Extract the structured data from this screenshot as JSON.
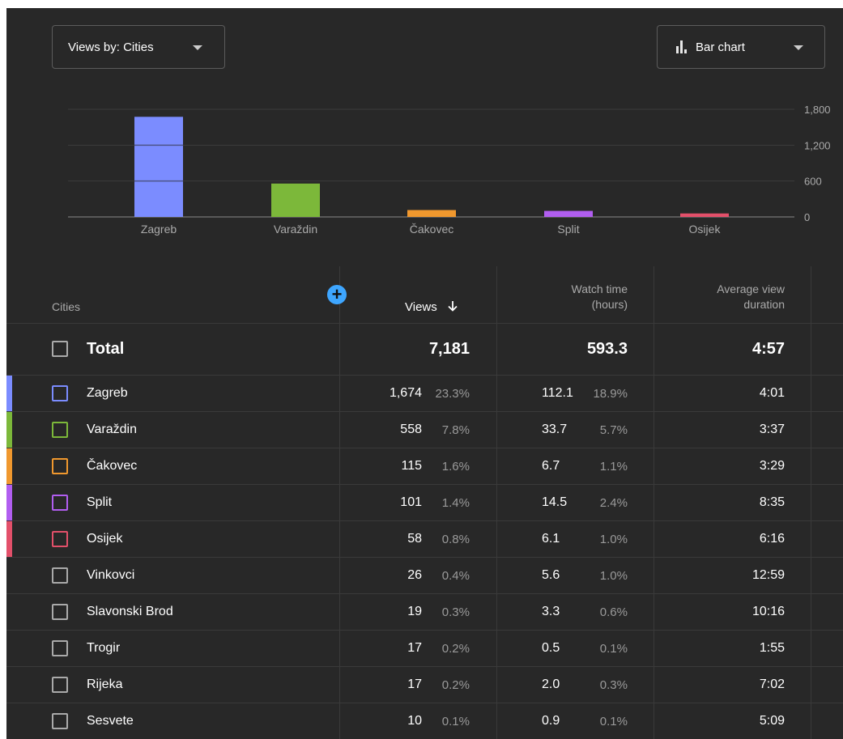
{
  "controls": {
    "metric_dropdown_label": "Views by: Cities",
    "chart_type_label": "Bar chart"
  },
  "chart_data": {
    "type": "bar",
    "categories": [
      "Zagreb",
      "Varaždin",
      "Čakovec",
      "Split",
      "Osijek"
    ],
    "values": [
      1674,
      558,
      115,
      101,
      58
    ],
    "colors": [
      "#7b8cff",
      "#7cb83a",
      "#f0982e",
      "#b15ef0",
      "#e3506a"
    ],
    "ytick_labels": [
      "1,800",
      "1,200",
      "600",
      "0"
    ],
    "yticks": [
      1800,
      1200,
      600,
      0
    ],
    "ylim": [
      0,
      1800
    ],
    "grid": true
  },
  "table": {
    "headers": {
      "cities": "Cities",
      "views": "Views",
      "views_sort_icon": "arrow-down-icon",
      "watch_time_1": "Watch time",
      "watch_time_2": "(hours)",
      "avg_1": "Average view",
      "avg_2": "duration",
      "add_metric_icon": "plus-circle-icon"
    },
    "total": {
      "label": "Total",
      "views": "7,181",
      "watch_time": "593.3",
      "avg_duration": "4:57"
    },
    "rows": [
      {
        "city": "Zagreb",
        "views": "1,674",
        "views_pct": "23.3%",
        "watch": "112.1",
        "watch_pct": "18.9%",
        "avg": "4:01",
        "color": "#7b8cff"
      },
      {
        "city": "Varaždin",
        "views": "558",
        "views_pct": "7.8%",
        "watch": "33.7",
        "watch_pct": "5.7%",
        "avg": "3:37",
        "color": "#7cb83a"
      },
      {
        "city": "Čakovec",
        "views": "115",
        "views_pct": "1.6%",
        "watch": "6.7",
        "watch_pct": "1.1%",
        "avg": "3:29",
        "color": "#f0982e"
      },
      {
        "city": "Split",
        "views": "101",
        "views_pct": "1.4%",
        "watch": "14.5",
        "watch_pct": "2.4%",
        "avg": "8:35",
        "color": "#b15ef0"
      },
      {
        "city": "Osijek",
        "views": "58",
        "views_pct": "0.8%",
        "watch": "6.1",
        "watch_pct": "1.0%",
        "avg": "6:16",
        "color": "#e3506a"
      },
      {
        "city": "Vinkovci",
        "views": "26",
        "views_pct": "0.4%",
        "watch": "5.6",
        "watch_pct": "1.0%",
        "avg": "12:59",
        "color": ""
      },
      {
        "city": "Slavonski Brod",
        "views": "19",
        "views_pct": "0.3%",
        "watch": "3.3",
        "watch_pct": "0.6%",
        "avg": "10:16",
        "color": ""
      },
      {
        "city": "Trogir",
        "views": "17",
        "views_pct": "0.2%",
        "watch": "0.5",
        "watch_pct": "0.1%",
        "avg": "1:55",
        "color": ""
      },
      {
        "city": "Rijeka",
        "views": "17",
        "views_pct": "0.2%",
        "watch": "2.0",
        "watch_pct": "0.3%",
        "avg": "7:02",
        "color": ""
      },
      {
        "city": "Sesvete",
        "views": "10",
        "views_pct": "0.1%",
        "watch": "0.9",
        "watch_pct": "0.1%",
        "avg": "5:09",
        "color": ""
      }
    ]
  }
}
